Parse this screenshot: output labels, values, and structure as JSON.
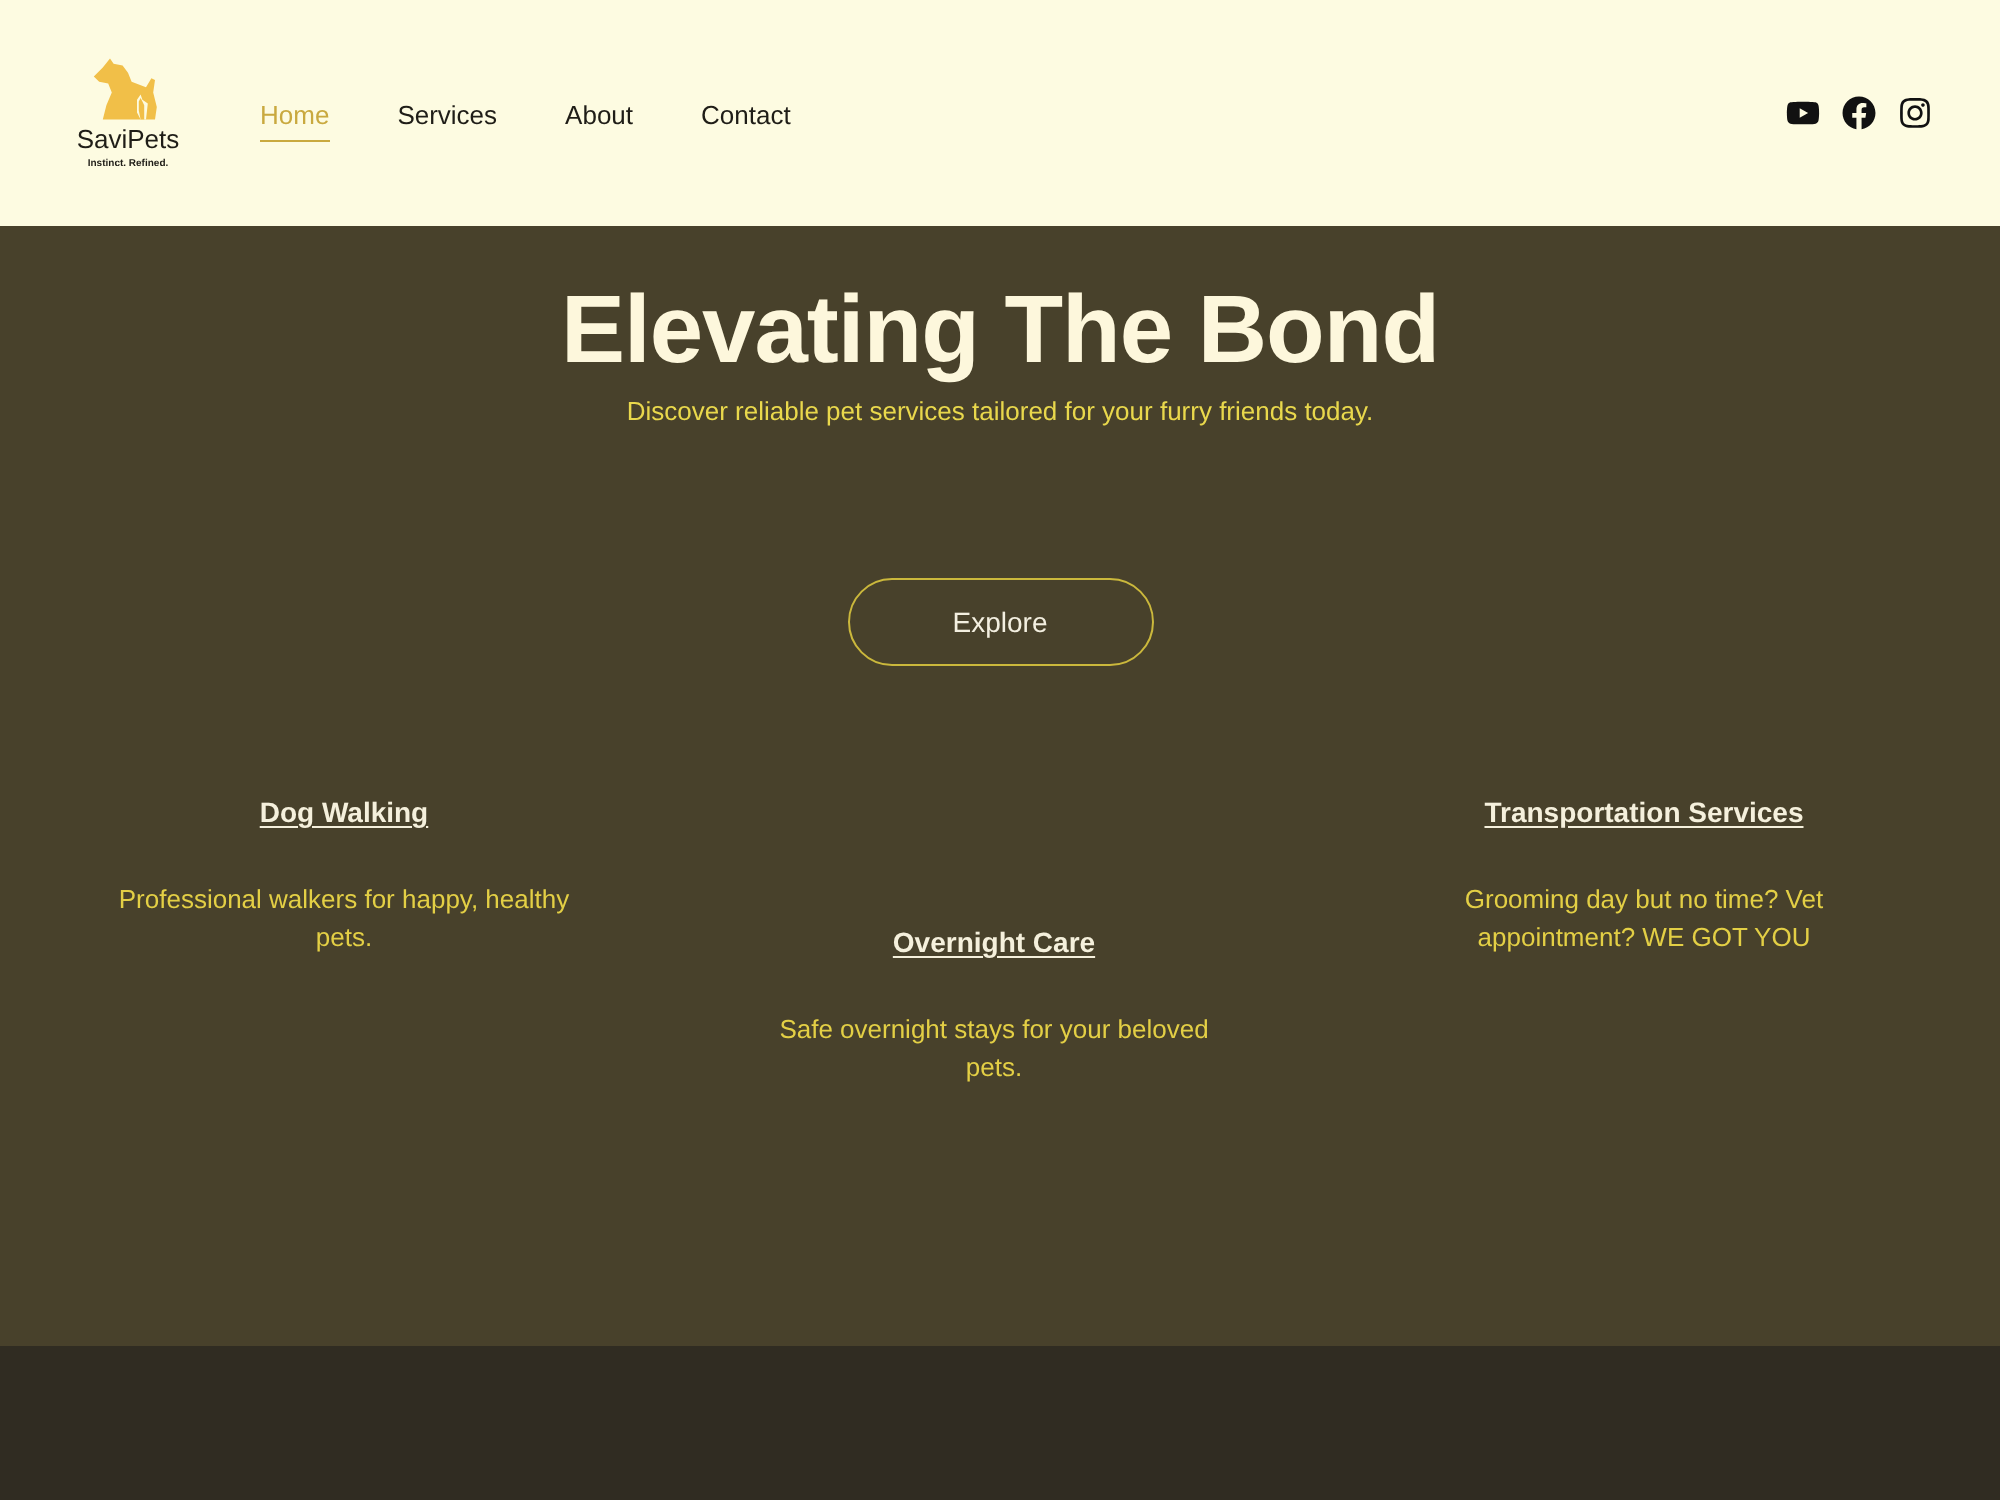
{
  "header": {
    "logo": {
      "name": "SaviPets",
      "tagline": "Instinct. Refined."
    },
    "nav": [
      {
        "label": "Home",
        "selected": true
      },
      {
        "label": "Services",
        "selected": false
      },
      {
        "label": "About",
        "selected": false
      },
      {
        "label": "Contact",
        "selected": false
      }
    ]
  },
  "hero": {
    "title": "Elevating The Bond",
    "subtitle": "Discover reliable pet services tailored for your furry friends today.",
    "button": "Explore"
  },
  "services": [
    {
      "title": "Dog Walking",
      "description": "Professional walkers for happy, healthy pets."
    },
    {
      "title": "Overnight Care",
      "description": "Safe overnight stays for your beloved pets."
    },
    {
      "title": "Transportation Services",
      "description": "Grooming day but no time? Vet appointment? WE GOT YOU"
    }
  ]
}
